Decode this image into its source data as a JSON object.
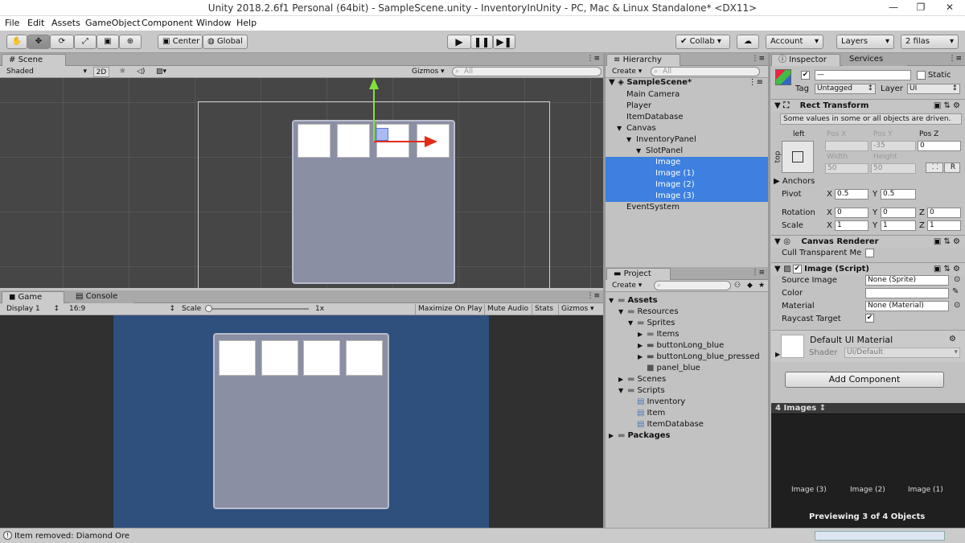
{
  "window": {
    "title": "Unity 2018.2.6f1 Personal (64bit) - SampleScene.unity - InventoryInUnity - PC, Mac & Linux Standalone* <DX11>",
    "minimize": "—",
    "maximize": "❐",
    "close": "✕"
  },
  "menu": [
    "File",
    "Edit",
    "Assets",
    "GameObject",
    "Component",
    "Window",
    "Help"
  ],
  "toolbar": {
    "center": "Center",
    "global": "Global",
    "collab": "Collab ▾",
    "account": "Account",
    "layers": "Layers",
    "layout": "2 filas"
  },
  "scene": {
    "tab": "Scene",
    "shading": "Shaded",
    "mode2d": "2D",
    "gizmos": "Gizmos ▾",
    "search": "All"
  },
  "game": {
    "tab": "Game",
    "console_tab": "Console",
    "display": "Display 1",
    "aspect": "16:9",
    "scale_label": "Scale",
    "scale_value": "1x",
    "maximize": "Maximize On Play",
    "mute": "Mute Audio",
    "stats": "Stats",
    "gizmos": "Gizmos"
  },
  "hierarchy": {
    "tab": "Hierarchy",
    "create": "Create ▾",
    "search": "All",
    "scene": "SampleScene*",
    "items": [
      {
        "label": "Main Camera",
        "indent": 1,
        "arrow": "",
        "sel": false
      },
      {
        "label": "Player",
        "indent": 1,
        "arrow": "",
        "sel": false
      },
      {
        "label": "ItemDatabase",
        "indent": 1,
        "arrow": "",
        "sel": false
      },
      {
        "label": "Canvas",
        "indent": 1,
        "arrow": "▼",
        "sel": false
      },
      {
        "label": "InventoryPanel",
        "indent": 2,
        "arrow": "▼",
        "sel": false
      },
      {
        "label": "SlotPanel",
        "indent": 3,
        "arrow": "▼",
        "sel": false
      },
      {
        "label": "Image",
        "indent": 4,
        "arrow": "",
        "sel": true
      },
      {
        "label": "Image (1)",
        "indent": 4,
        "arrow": "",
        "sel": true
      },
      {
        "label": "Image (2)",
        "indent": 4,
        "arrow": "",
        "sel": true
      },
      {
        "label": "Image (3)",
        "indent": 4,
        "arrow": "",
        "sel": true
      },
      {
        "label": "EventSystem",
        "indent": 1,
        "arrow": "",
        "sel": false
      }
    ]
  },
  "project": {
    "tab": "Project",
    "create": "Create ▾",
    "items": [
      {
        "label": "Assets",
        "indent": 0,
        "arrow": "▼",
        "icon": "folder",
        "bold": true
      },
      {
        "label": "Resources",
        "indent": 1,
        "arrow": "▼",
        "icon": "folder",
        "bold": false
      },
      {
        "label": "Sprites",
        "indent": 2,
        "arrow": "▼",
        "icon": "folder",
        "bold": false
      },
      {
        "label": "Items",
        "indent": 3,
        "arrow": "▶",
        "icon": "folder",
        "bold": false
      },
      {
        "label": "buttonLong_blue",
        "indent": 3,
        "arrow": "▶",
        "icon": "sprite",
        "bold": false
      },
      {
        "label": "buttonLong_blue_pressed",
        "indent": 3,
        "arrow": "▶",
        "icon": "sprite",
        "bold": false
      },
      {
        "label": "panel_blue",
        "indent": 3,
        "arrow": "",
        "icon": "panel",
        "bold": false
      },
      {
        "label": "Scenes",
        "indent": 1,
        "arrow": "▶",
        "icon": "folder",
        "bold": false
      },
      {
        "label": "Scripts",
        "indent": 1,
        "arrow": "▼",
        "icon": "folder",
        "bold": false
      },
      {
        "label": "Inventory",
        "indent": 2,
        "arrow": "",
        "icon": "script",
        "bold": false
      },
      {
        "label": "Item",
        "indent": 2,
        "arrow": "",
        "icon": "script",
        "bold": false
      },
      {
        "label": "ItemDatabase",
        "indent": 2,
        "arrow": "",
        "icon": "script",
        "bold": false
      },
      {
        "label": "Packages",
        "indent": 0,
        "arrow": "▶",
        "icon": "folder",
        "bold": true
      }
    ]
  },
  "inspector": {
    "tab": "Inspector",
    "services_tab": "Services",
    "name_value": "—",
    "static_label": "Static",
    "tag_label": "Tag",
    "tag_value": "Untagged",
    "layer_label": "Layer",
    "layer_value": "UI",
    "rect_title": "Rect Transform",
    "driven_note": "Some values in some or all objects are driven.",
    "anchor_h": "left",
    "anchor_v": "top",
    "posx_label": "Pos X",
    "posy_label": "Pos Y",
    "posz_label": "Pos Z",
    "posx": "",
    "posy": "-35",
    "posz": "0",
    "width_label": "Width",
    "height_label": "Height",
    "width": "50",
    "height": "50",
    "r_button": "R",
    "anchors_label": "Anchors",
    "pivot_label": "Pivot",
    "pivot_x": "0.5",
    "pivot_y": "0.5",
    "rotation_label": "Rotation",
    "rot_x": "0",
    "rot_y": "0",
    "rot_z": "0",
    "scale_label": "Scale",
    "scale_x": "1",
    "scale_y": "1",
    "scale_z": "1",
    "canvas_renderer": "Canvas Renderer",
    "cull_label": "Cull Transparent Me",
    "image_script": "Image (Script)",
    "source_label": "Source Image",
    "source_value": "None (Sprite)",
    "color_label": "Color",
    "material_label": "Material",
    "material_value": "None (Material)",
    "raycast_label": "Raycast Target",
    "default_mat": "Default UI Material",
    "shader_label": "Shader",
    "shader_value": "UI/Default",
    "add_component": "Add Component",
    "images_count": "4 Images ↕",
    "preview_items": [
      "Image (3)",
      "Image (2)",
      "Image (1)"
    ],
    "previewing": "Previewing 3 of 4 Objects"
  },
  "status": {
    "message": "Item removed: Diamond Ore"
  },
  "colors": {
    "selection": "#3d80df",
    "game_bg": "#2f4f7d",
    "panel": "#8a8fa4",
    "accent_red": "#e22b16",
    "accent_green": "#7fe33a"
  }
}
